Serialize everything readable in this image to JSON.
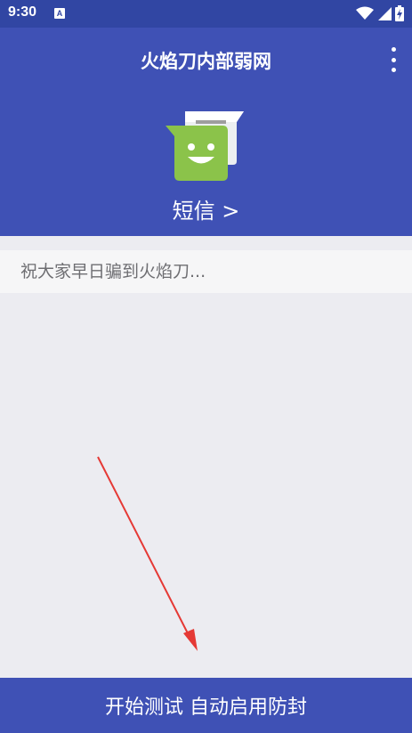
{
  "status_bar": {
    "time": "9:30",
    "notification_badge": "A",
    "icons": [
      "wifi-icon",
      "signal-icon",
      "battery-charging-icon"
    ]
  },
  "app": {
    "title": "火焰刀内部弱网",
    "menu_icon": "more-vert-icon"
  },
  "header": {
    "sms_icon": "sms-message-icon",
    "sms_label": "短信 >"
  },
  "message": {
    "placeholder": "祝大家早日骗到火焰刀..."
  },
  "footer": {
    "start_button_label": "开始测试 自动启用防封"
  },
  "colors": {
    "status_bar": "#3146a3",
    "primary": "#3f51b5",
    "background": "#ececf1",
    "icon_green": "#8bc34a",
    "arrow_red": "#e53935"
  }
}
